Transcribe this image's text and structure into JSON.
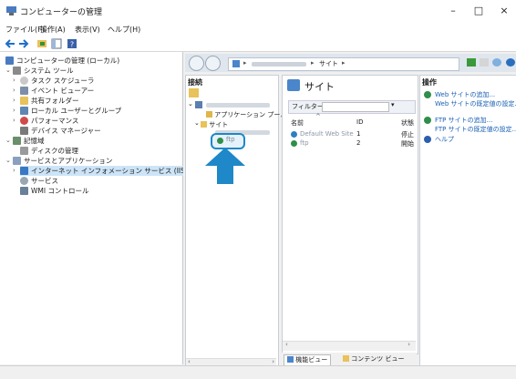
{
  "window": {
    "title": "コンピューターの管理",
    "minimize_icon": "–",
    "maximize_icon": "□",
    "close_icon": "×"
  },
  "menu": [
    "ファイル(F)",
    "操作(A)",
    "表示(V)",
    "ヘルプ(H)"
  ],
  "tree": {
    "items": [
      {
        "label": "コンピューターの管理 (ローカル)",
        "icon": "computer-management-icon"
      },
      {
        "label": "システム ツール",
        "icon": "tools-icon"
      },
      {
        "label": "タスク スケジューラ",
        "icon": "clock-icon"
      },
      {
        "label": "イベント ビューアー",
        "icon": "event-icon"
      },
      {
        "label": "共有フォルダー",
        "icon": "shared-folder-icon"
      },
      {
        "label": "ローカル ユーザーとグループ",
        "icon": "users-icon"
      },
      {
        "label": "パフォーマンス",
        "icon": "performance-icon"
      },
      {
        "label": "デバイス マネージャー",
        "icon": "device-icon"
      },
      {
        "label": "記憶域",
        "icon": "storage-icon"
      },
      {
        "label": "ディスクの管理",
        "icon": "disk-icon"
      },
      {
        "label": "サービスとアプリケーション",
        "icon": "services-apps-icon"
      },
      {
        "label": "インターネット インフォメーション サービス (IIS) マネージャー",
        "icon": "iis-icon"
      },
      {
        "label": "サービス",
        "icon": "gear-icon"
      },
      {
        "label": "WMI コントロール",
        "icon": "wmi-icon"
      }
    ]
  },
  "iis": {
    "address": {
      "crumb_sep": "▸",
      "crumb_sites": "サイト"
    },
    "connections": {
      "title": "接続",
      "app_pool": "アプリケーション プール",
      "sites": "サイト",
      "site_ftp": "ftp"
    },
    "center": {
      "title": "サイト",
      "filter_label": "フィルター:",
      "col_name": "名前",
      "col_id": "ID",
      "col_status": "状態",
      "rows": [
        {
          "name": "Default Web Site",
          "id": "1",
          "status": "停止"
        },
        {
          "name": "ftp",
          "id": "2",
          "status": "開始"
        }
      ],
      "tab_features": "機能ビュー",
      "tab_content": "コンテンツ ビュー"
    },
    "actions": {
      "title": "操作",
      "items": [
        "Web サイトの追加...",
        "Web サイトの既定値の設定...",
        "FTP サイトの追加...",
        "FTP サイトの既定値の設定...",
        "ヘルプ"
      ]
    }
  },
  "colors": {
    "accent_arrow": "#1e88c8",
    "link": "#1a5fb4"
  }
}
